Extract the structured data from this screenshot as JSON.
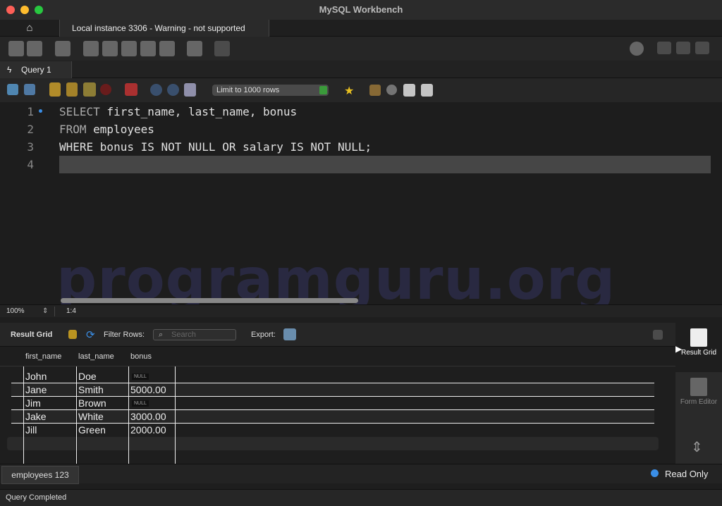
{
  "window": {
    "title": "MySQL Workbench"
  },
  "tabs": {
    "home_icon": "home-icon",
    "connection": "Local instance 3306 - Warning - not supported"
  },
  "query_tab": {
    "label": "Query 1"
  },
  "editor_toolbar": {
    "limit": "Limit to 1000 rows"
  },
  "editor": {
    "lines": [
      {
        "num": "1",
        "kw1": "SELECT",
        "rest1": " first_name, last_name, bonus"
      },
      {
        "num": "2",
        "kw1": "FROM",
        "rest1": " employees"
      },
      {
        "num": "3",
        "text": "WHERE bonus IS NOT NULL OR salary IS NOT NULL;"
      },
      {
        "num": "4"
      }
    ],
    "watermark": "programguru.org"
  },
  "editor_status": {
    "zoom": "100%",
    "position": "1:4"
  },
  "result_toolbar": {
    "title": "Result Grid",
    "filter_label": "Filter Rows:",
    "search_placeholder": "Search",
    "export_label": "Export:"
  },
  "grid": {
    "columns": [
      "first_name",
      "last_name",
      "bonus"
    ],
    "rows": [
      [
        "John",
        "Doe",
        "NULL"
      ],
      [
        "Jane",
        "Smith",
        "5000.00"
      ],
      [
        "Jim",
        "Brown",
        "NULL"
      ],
      [
        "Jake",
        "White",
        "3000.00"
      ],
      [
        "Jill",
        "Green",
        "2000.00"
      ]
    ]
  },
  "side": {
    "result_grid": "Result Grid",
    "form_editor": "Form Editor"
  },
  "bottom": {
    "tab": "employees 123",
    "readonly": "Read Only"
  },
  "status": {
    "text": "Query Completed"
  }
}
